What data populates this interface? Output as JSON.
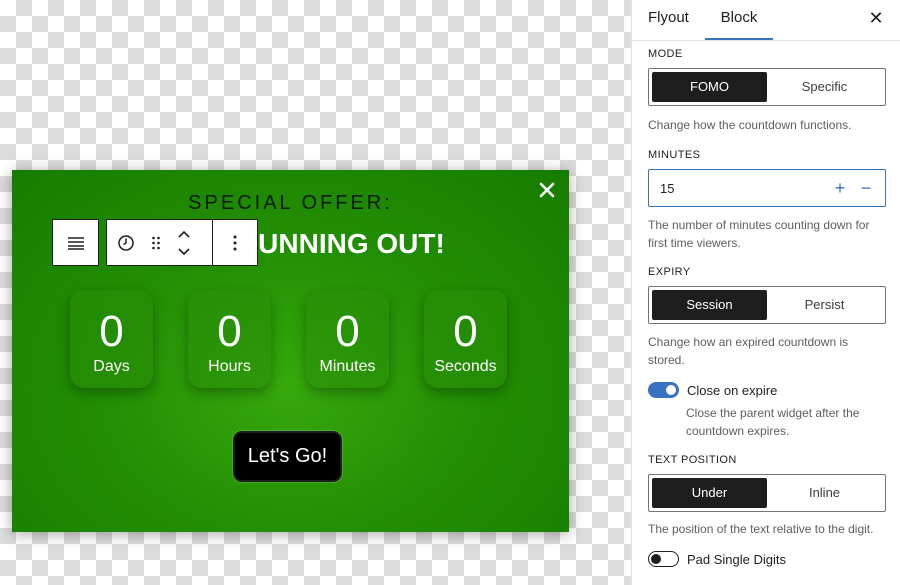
{
  "popup": {
    "eyebrow": "SPECIAL OFFER:",
    "headline": "UNNING OUT!",
    "close_icon": "close-icon",
    "countdown": [
      {
        "value": "0",
        "label": "Days"
      },
      {
        "value": "0",
        "label": "Hours"
      },
      {
        "value": "0",
        "label": "Minutes"
      },
      {
        "value": "0",
        "label": "Seconds"
      }
    ],
    "cta_label": "Let's Go!"
  },
  "toolbar": {
    "icons": [
      "align-icon",
      "clock-icon",
      "drag-handle-icon",
      "move-up-down-icon",
      "more-options-icon"
    ]
  },
  "sidebar": {
    "tabs": [
      {
        "label": "Flyout"
      },
      {
        "label": "Block"
      }
    ],
    "active_tab": "Block",
    "close_glyph": "✕",
    "mode": {
      "label": "MODE",
      "options": [
        "FOMO",
        "Specific"
      ],
      "selected": "FOMO",
      "help": "Change how the countdown functions."
    },
    "minutes": {
      "label": "MINUTES",
      "value": "15",
      "plus": "+",
      "minus": "−",
      "help": "The number of minutes counting down for first time viewers."
    },
    "expiry": {
      "label": "EXPIRY",
      "options": [
        "Session",
        "Persist"
      ],
      "selected": "Session",
      "help": "Change how an expired countdown is stored."
    },
    "close_on_expire": {
      "label": "Close on expire",
      "enabled": true,
      "help": "Close the parent widget after the countdown expires."
    },
    "text_position": {
      "label": "TEXT POSITION",
      "options": [
        "Under",
        "Inline"
      ],
      "selected": "Under",
      "help": "The position of the text relative to the digit."
    },
    "pad_single_digits": {
      "label": "Pad Single Digits",
      "enabled": false
    }
  },
  "colors": {
    "popup_green": "#1f8a04",
    "accent_blue": "#3a71c1",
    "dark": "#1e1e1e"
  }
}
